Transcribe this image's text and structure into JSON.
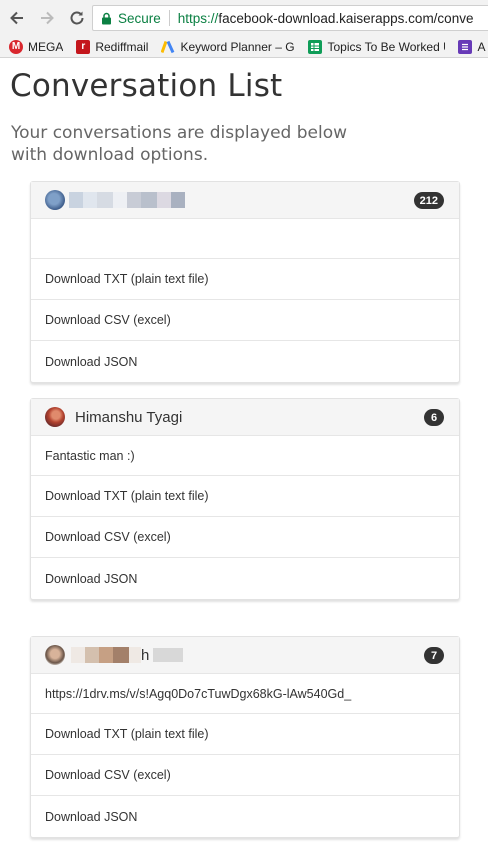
{
  "browser": {
    "secure_label": "Secure",
    "url_scheme": "https://",
    "url_rest": "facebook-download.kaiserapps.com/conve"
  },
  "bookmarks": [
    {
      "label": "MEGA",
      "icon": "mega-icon",
      "color": "#d9272e"
    },
    {
      "label": "Rediffmail",
      "icon": "rediffmail-icon",
      "color": "#c4161c"
    },
    {
      "label": "Keyword Planner – Go",
      "icon": "google-ads-icon",
      "color": "#4285f4"
    },
    {
      "label": "Topics To Be Worked U",
      "icon": "sheets-icon",
      "color": "#0f9d58"
    },
    {
      "label": "A",
      "icon": "forms-icon",
      "color": "#673ab7"
    }
  ],
  "page": {
    "title": "Conversation List",
    "subtitle": "Your conversations are displayed below with download options."
  },
  "conversations": [
    {
      "name": "",
      "count": "212",
      "message": "",
      "actions": [
        "Download TXT (plain text file)",
        "Download CSV (excel)",
        "Download JSON"
      ]
    },
    {
      "name": "Himanshu Tyagi",
      "count": "6",
      "message": "Fantastic man :)",
      "actions": [
        "Download TXT (plain text file)",
        "Download CSV (excel)",
        "Download JSON"
      ]
    },
    {
      "name": "h",
      "count": "7",
      "message": "https://1drv.ms/v/s!Agq0Do7cTuwDgx68kG-lAw540Gd_",
      "actions": [
        "Download TXT (plain text file)",
        "Download CSV (excel)",
        "Download JSON"
      ]
    }
  ]
}
